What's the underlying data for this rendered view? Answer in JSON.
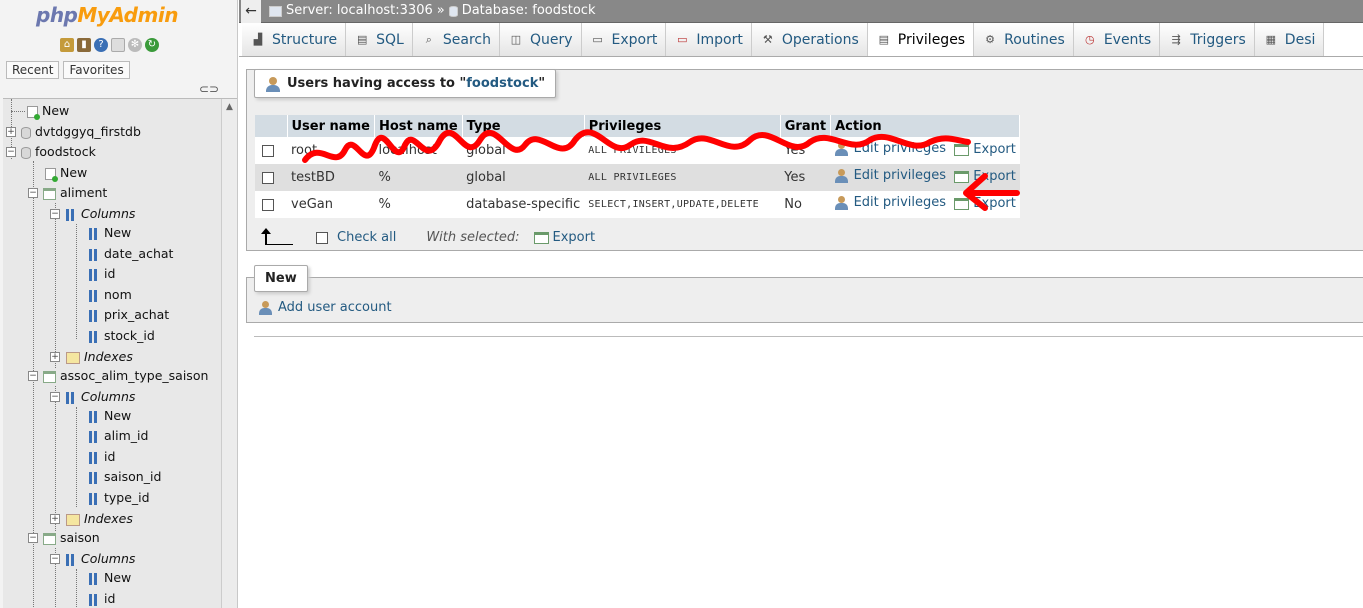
{
  "sidebar": {
    "logo_php": "php",
    "logo_myadmin": "MyAdmin",
    "tabs": {
      "recent": "Recent",
      "favorites": "Favorites"
    },
    "tree": {
      "new": "New",
      "db1": "dvtdggyq_firstdb",
      "db2": "foodstock",
      "db2_new": "New",
      "t1": "aliment",
      "t1_columns": "Columns",
      "t1_cols": [
        "New",
        "date_achat",
        "id",
        "nom",
        "prix_achat",
        "stock_id"
      ],
      "t1_indexes": "Indexes",
      "t2": "assoc_alim_type_saison",
      "t2_columns": "Columns",
      "t2_cols": [
        "New",
        "alim_id",
        "id",
        "saison_id",
        "type_id"
      ],
      "t2_indexes": "Indexes",
      "t3": "saison",
      "t3_columns": "Columns",
      "t3_cols": [
        "New",
        "id"
      ]
    }
  },
  "topbar": {
    "back": "←",
    "server": "Server: localhost:3306",
    "sep": "»",
    "database": "Database: foodstock"
  },
  "tabs": [
    {
      "label": "Structure",
      "icon": "structure-icon"
    },
    {
      "label": "SQL",
      "icon": "sql-icon"
    },
    {
      "label": "Search",
      "icon": "search-icon"
    },
    {
      "label": "Query",
      "icon": "query-icon"
    },
    {
      "label": "Export",
      "icon": "export-icon"
    },
    {
      "label": "Import",
      "icon": "import-icon"
    },
    {
      "label": "Operations",
      "icon": "wrench-icon"
    },
    {
      "label": "Privileges",
      "icon": "privileges-icon"
    },
    {
      "label": "Routines",
      "icon": "routines-icon"
    },
    {
      "label": "Events",
      "icon": "clock-icon"
    },
    {
      "label": "Triggers",
      "icon": "triggers-icon"
    },
    {
      "label": "Desi",
      "icon": "designer-icon"
    }
  ],
  "users": {
    "legend_prefix": "Users having access to \"",
    "legend_db": "foodstock",
    "legend_suffix": "\"",
    "headers": {
      "user": "User name",
      "host": "Host name",
      "type": "Type",
      "privileges": "Privileges",
      "grant": "Grant",
      "action": "Action"
    },
    "rows": [
      {
        "user": "root",
        "host": "localhost",
        "type": "global",
        "privileges": "ALL PRIVILEGES",
        "grant": "Yes",
        "edit": "Edit privileges",
        "export": "Export"
      },
      {
        "user": "testBD",
        "host": "%",
        "type": "global",
        "privileges": "ALL PRIVILEGES",
        "grant": "Yes",
        "edit": "Edit privileges",
        "export": "Export"
      },
      {
        "user": "veGan",
        "host": "%",
        "type": "database-specific",
        "privileges": "SELECT,INSERT,UPDATE,DELETE",
        "grant": "No",
        "edit": "Edit privileges",
        "export": "Export"
      }
    ],
    "check_all": "Check all",
    "with_selected": "With selected:",
    "bulk_export": "Export"
  },
  "new_section": {
    "legend": "New",
    "add_user": "Add user account"
  },
  "colors": {
    "link": "#235a81",
    "header_bg": "#d3dce3",
    "scribble": "#ff0000",
    "logo_php": "#6c78af",
    "logo_myadmin": "#f89c0e"
  }
}
